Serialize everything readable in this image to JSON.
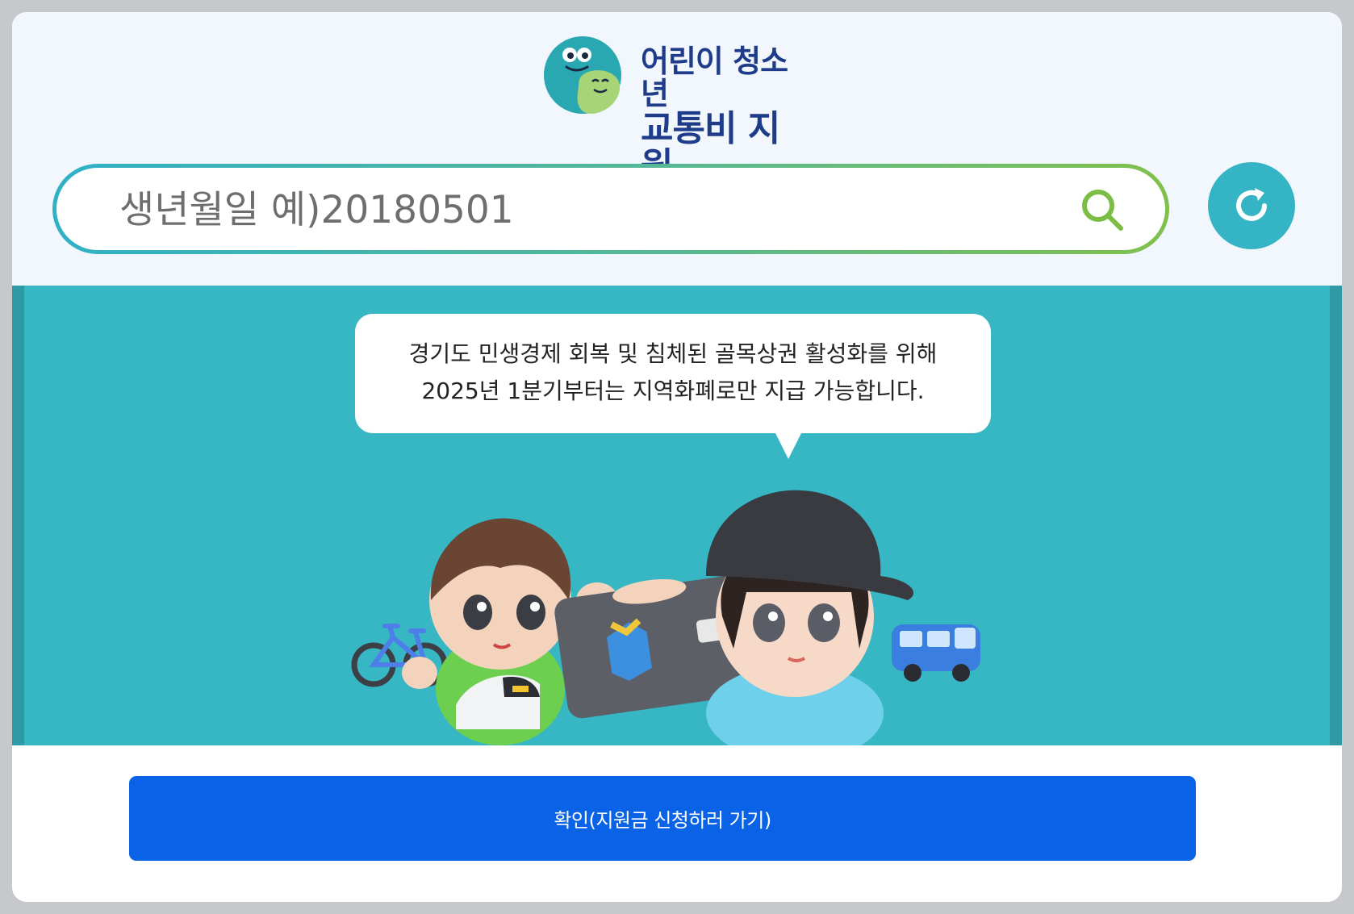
{
  "app": {
    "logo_line1": "어린이 청소년",
    "logo_line2": "교통비 지원"
  },
  "search": {
    "placeholder": "생년월일 예)20180501",
    "value": "",
    "search_icon": "search-icon",
    "refresh_icon": "refresh-icon"
  },
  "notice": {
    "line1": "경기도 민생경제 회복 및 침체된 골목상권 활성화를 위해",
    "line2": "2025년 1분기부터는 지역화폐로만 지급 가능합니다."
  },
  "confirm": {
    "label": "확인(지원금 신청하러 가기)"
  },
  "colors": {
    "teal": "#37b6c4",
    "brand_navy": "#1f3c8a",
    "button_blue": "#0a63e6",
    "gradient_start": "#2fb1c6",
    "gradient_end": "#80c04c"
  }
}
